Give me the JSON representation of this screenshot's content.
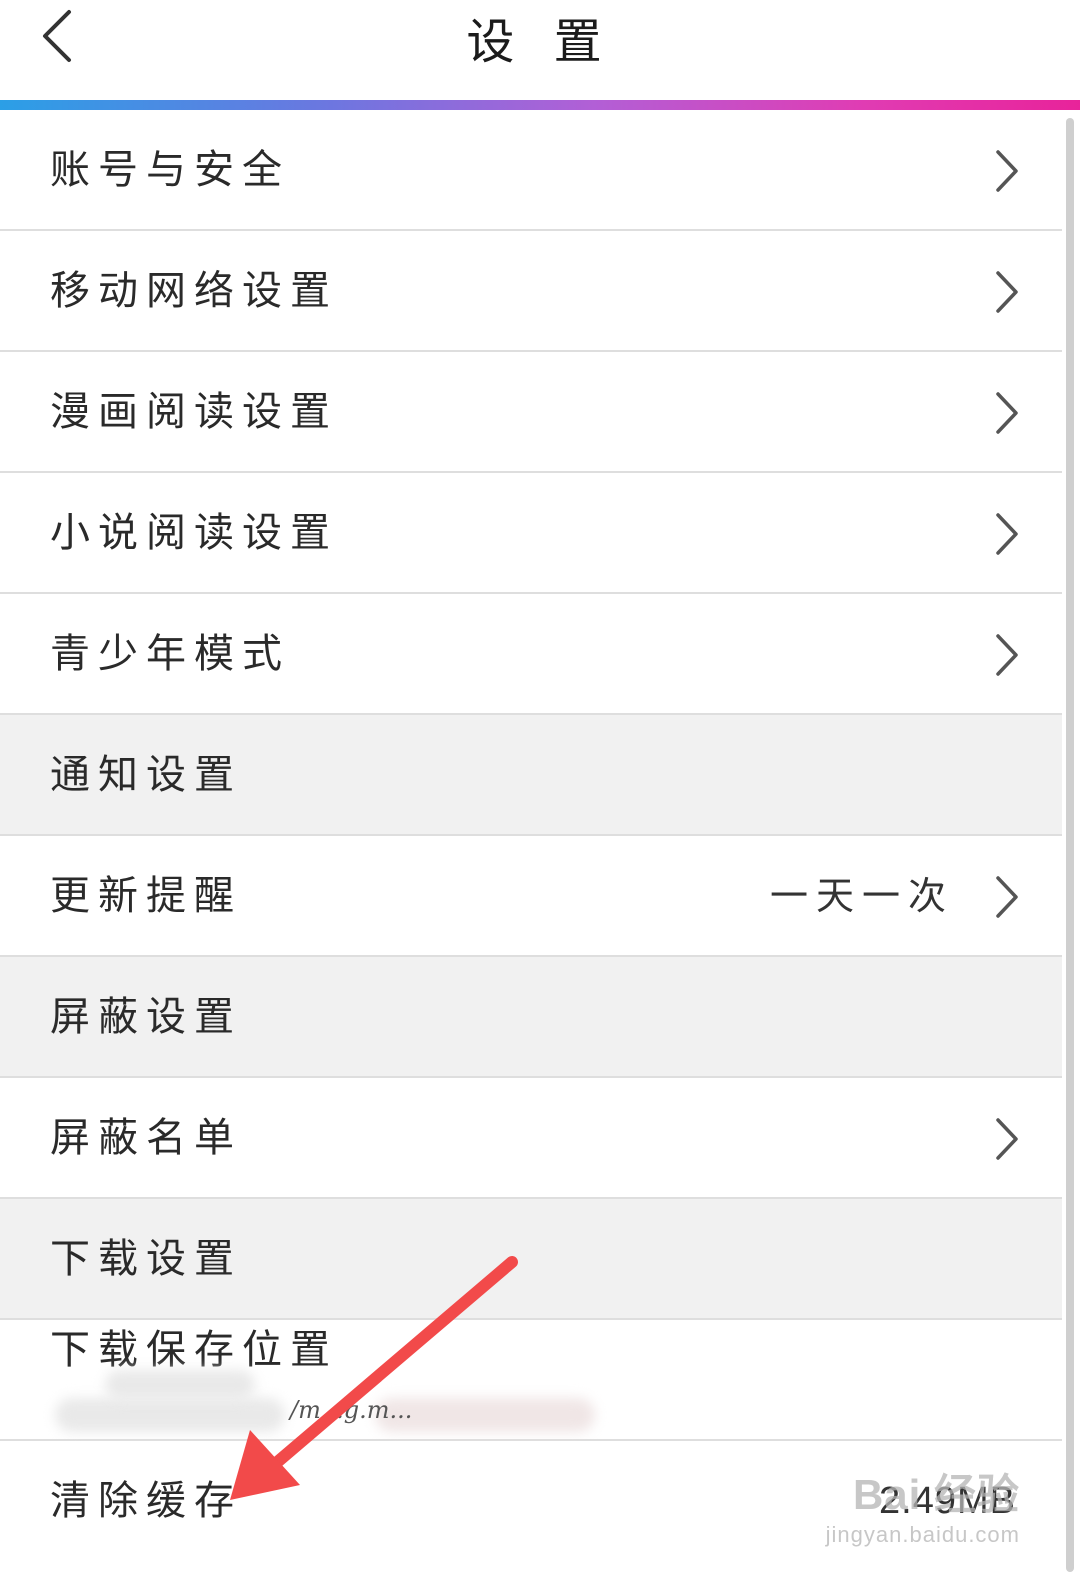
{
  "header": {
    "title": "设 置",
    "back_icon": "chevron-left-icon"
  },
  "colors": {
    "accent_gradient": [
      "#2b9fe6",
      "#b25fd6",
      "#e8239a"
    ],
    "section_bg": "#f1f1f1",
    "arrow_annotation": "#f24a4a"
  },
  "settings": {
    "account_security": "账号与安全",
    "mobile_network": "移动网络设置",
    "comic_reading": "漫画阅读设置",
    "novel_reading": "小说阅读设置",
    "teen_mode": "青少年模式",
    "notification_section": "通知设置",
    "update_reminder": "更新提醒",
    "update_reminder_value": "一天一次",
    "block_section": "屏蔽设置",
    "block_list": "屏蔽名单",
    "download_section": "下载设置",
    "download_location": "下载保存位置",
    "download_path_partial": "/m...g.m...",
    "clear_cache": "清除缓存",
    "cache_size": "2.49MB"
  },
  "watermark": {
    "main": "Bai 经验",
    "sub": "jingyan.baidu.com"
  }
}
